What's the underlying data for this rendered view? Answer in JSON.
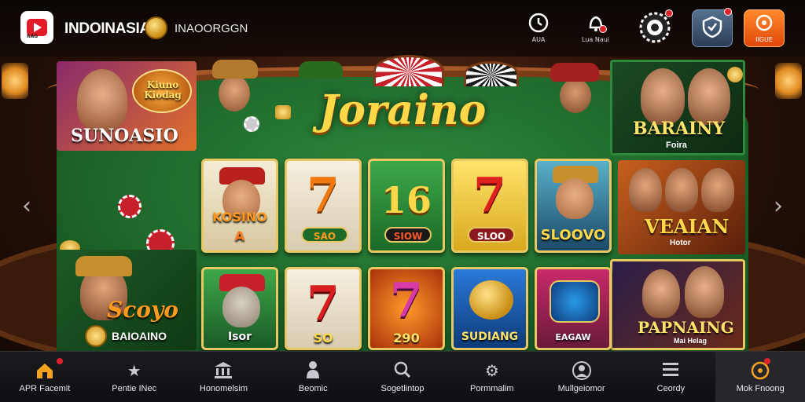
{
  "header": {
    "logo_tiny": "RAG",
    "brand": "INDOINASIA",
    "subbrand": "INAOORGGN",
    "icons": [
      {
        "name": "clock-icon",
        "label": "AUA"
      },
      {
        "name": "bell-icon",
        "label": "Lua Naui"
      },
      {
        "name": "roulette-icon",
        "label": ""
      },
      {
        "name": "shield-icon",
        "label": ""
      },
      {
        "name": "orange-action-icon",
        "label": "IIGUE"
      }
    ]
  },
  "stage": {
    "title": "Joraino",
    "prev_arrow": "‹",
    "next_arrow": "›"
  },
  "banners": {
    "top_left": {
      "badge": "Kiuno Kiodag",
      "label": "SUNOASIO"
    },
    "bottom_left": {
      "label": "Scoyo",
      "sublabel": "BAIOAINO"
    },
    "top_right": {
      "label": "BARAINY",
      "sublabel": "Foira"
    },
    "mid_right": {
      "label": "VEAIAN",
      "sublabel": "Hotor"
    },
    "bottom_right": {
      "label": "PAPNAING",
      "sublabel": "Mai Helag"
    }
  },
  "tiles": [
    {
      "label": "KOSINO",
      "sub": "A"
    },
    {
      "symbol": "7",
      "pill": "SAO"
    },
    {
      "symbol": "16",
      "pill": "SIOW"
    },
    {
      "symbol": "7",
      "pill": "SLOO"
    },
    {
      "label": "SLOOVO"
    },
    {
      "label": "Isor"
    },
    {
      "symbol": "7",
      "label": "SO"
    },
    {
      "symbol": "7",
      "label": "290"
    },
    {
      "label": "SUDIANG"
    },
    {
      "label": "EAGAW"
    }
  ],
  "bottom_nav": [
    {
      "icon": "home-icon",
      "label": "APR Facemit"
    },
    {
      "icon": "star-icon",
      "label": "Pentie INec"
    },
    {
      "icon": "bank-icon",
      "label": "Honomelsim"
    },
    {
      "icon": "person-icon",
      "label": "Beomic"
    },
    {
      "icon": "search-icon",
      "label": "Sogetlintop"
    },
    {
      "icon": "gear-icon",
      "label": "Pormmalim"
    },
    {
      "icon": "user-icon",
      "label": "Mullgeiomor"
    },
    {
      "icon": "list-icon",
      "label": "Ceordy"
    },
    {
      "icon": "coin-icon",
      "label": "Mok Fnoong"
    }
  ],
  "colors": {
    "accent": "#f6a21e",
    "felt": "#1f6a2c",
    "gold": "#ffd84a",
    "badge": "#e0202a"
  }
}
